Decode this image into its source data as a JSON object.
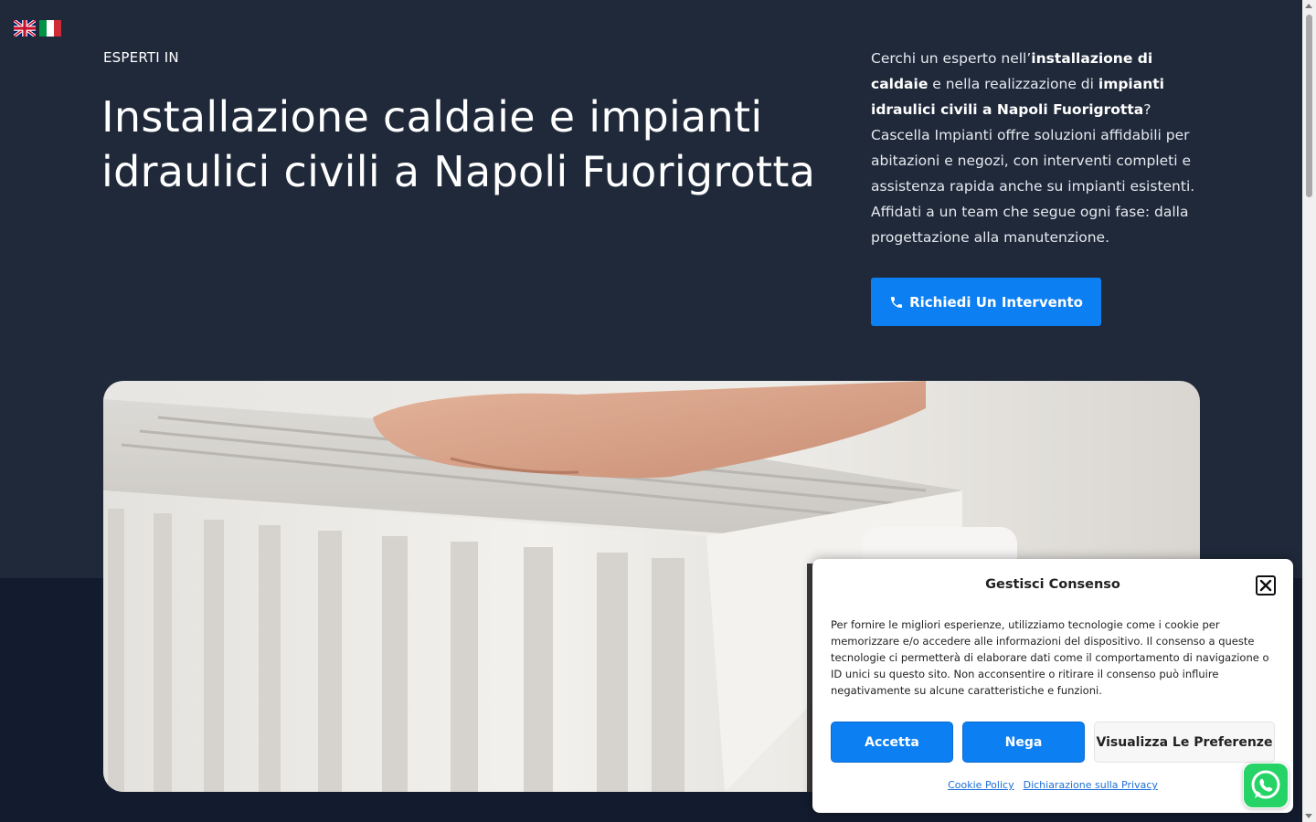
{
  "header": {
    "flags": [
      {
        "name": "English",
        "icon": "uk-flag-icon"
      },
      {
        "name": "Italiano",
        "icon": "italy-flag-icon"
      }
    ]
  },
  "hero": {
    "eyebrow": "ESPERTI IN",
    "title": "Installazione caldaie e impianti idraulici civili a Napoli Fuorigrotta",
    "intro": {
      "t1": "Cerchi un esperto nell’",
      "b1": "installazione di caldaie",
      "t2": " e nella realizzazione di ",
      "b2": "impianti idraulici civili a Napoli Fuorigrotta",
      "t3": "? Cascella Impianti offre soluzioni affidabili per abitazioni e negozi, con interventi completi e assistenza rapida anche su impianti esistenti. Affidati a un team che segue ogni fase: dalla progettazione alla manutenzione."
    },
    "cta_label": "Richiedi Un Intervento",
    "cta_icon": "phone-icon"
  },
  "cookie": {
    "title": "Gestisci Consenso",
    "text": "Per fornire le migliori esperienze, utilizziamo tecnologie come i cookie per memorizzare e/o accedere alle informazioni del dispositivo. Il consenso a queste tecnologie ci permetterà di elaborare dati come il comportamento di navigazione o ID unici su questo sito. Non acconsentire o ritirare il consenso può influire negativamente su alcune caratteristiche e funzioni.",
    "accept": "Accetta",
    "deny": "Nega",
    "prefs": "Visualizza Le Preferenze",
    "link_cookie": "Cookie Policy",
    "link_privacy": "Dichiarazione sulla Privacy"
  },
  "colors": {
    "hero_bg": "#1f293a",
    "page_bg": "#131b2e",
    "accent": "#0c7ff2",
    "whatsapp": "#25d366"
  }
}
